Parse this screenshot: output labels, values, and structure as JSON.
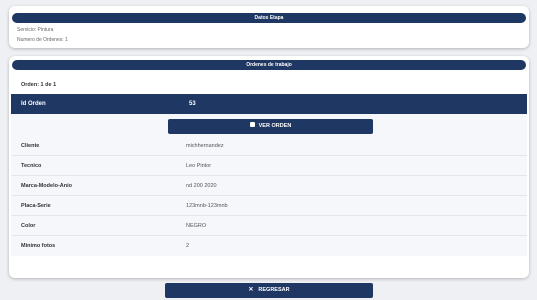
{
  "etapa": {
    "title": "Datos Etapa",
    "servicio": "Servicio: Pintura",
    "numero_ordenes": "Numero de Ordenes: 1"
  },
  "ordenes": {
    "title": "Ordenes de trabajo",
    "count": "Orden: 1 de 1",
    "id_label": "Id Orden",
    "id_value": "53",
    "ver_orden": "VER ORDEN",
    "rows": [
      {
        "label": "Cliente",
        "value": "michhernandez"
      },
      {
        "label": "Tecnico",
        "value": "Leo   Pintor"
      },
      {
        "label": "Marca-Modelo-Anio",
        "value": "nd 200 2020"
      },
      {
        "label": "Placa-Serie",
        "value": "123mnb-123mnb"
      },
      {
        "label": "Color",
        "value": "NEGRO"
      },
      {
        "label": "Minimo fotos",
        "value": "2"
      }
    ]
  },
  "regresar": {
    "label": "REGRESAR",
    "icon": "close-icon"
  },
  "colors": {
    "primary": "#1f3763",
    "background": "#eef0f3"
  }
}
